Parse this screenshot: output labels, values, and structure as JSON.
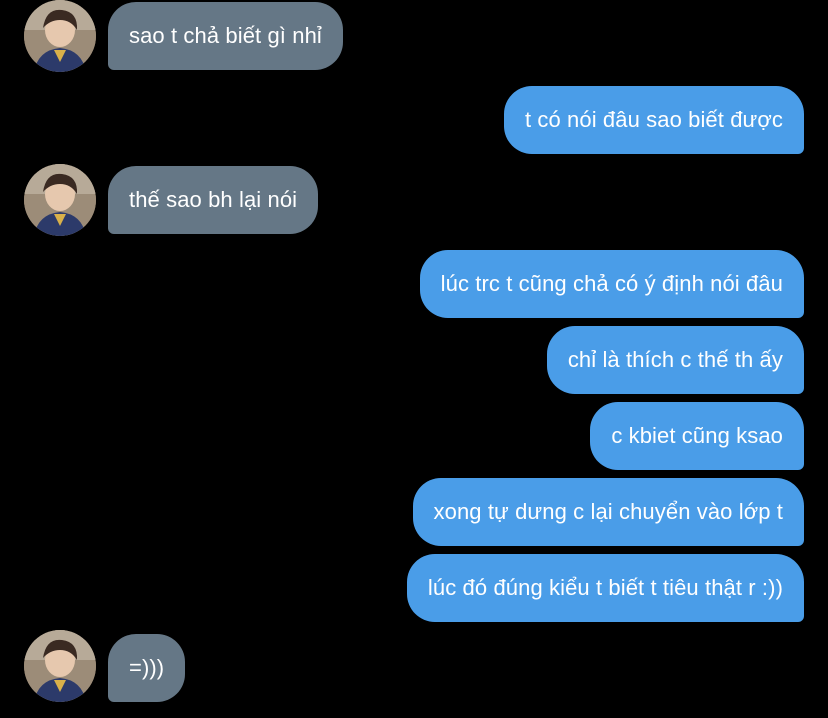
{
  "theme": {
    "background": "#000000",
    "received_bubble": "#657786",
    "sent_bubble": "#4a9de8",
    "text": "#ffffff"
  },
  "messages": [
    {
      "direction": "received",
      "text": "sao t chả biết gì nhỉ",
      "avatar": "contact-avatar"
    },
    {
      "direction": "sent",
      "text": "t có nói đâu sao biết được"
    },
    {
      "direction": "received",
      "text": "thế sao bh lại nói",
      "avatar": "contact-avatar"
    },
    {
      "direction": "sent",
      "text": "lúc trc t cũng chả có ý định nói đâu"
    },
    {
      "direction": "sent",
      "text": "chỉ là thích c thế th ấy"
    },
    {
      "direction": "sent",
      "text": "c kbiet cũng ksao"
    },
    {
      "direction": "sent",
      "text": "xong tự dưng c lại chuyển vào lớp t"
    },
    {
      "direction": "sent",
      "text": "lúc đó đúng kiểu t biết t tiêu thật r :))"
    },
    {
      "direction": "received",
      "text": "=)))",
      "avatar": "contact-avatar"
    }
  ]
}
